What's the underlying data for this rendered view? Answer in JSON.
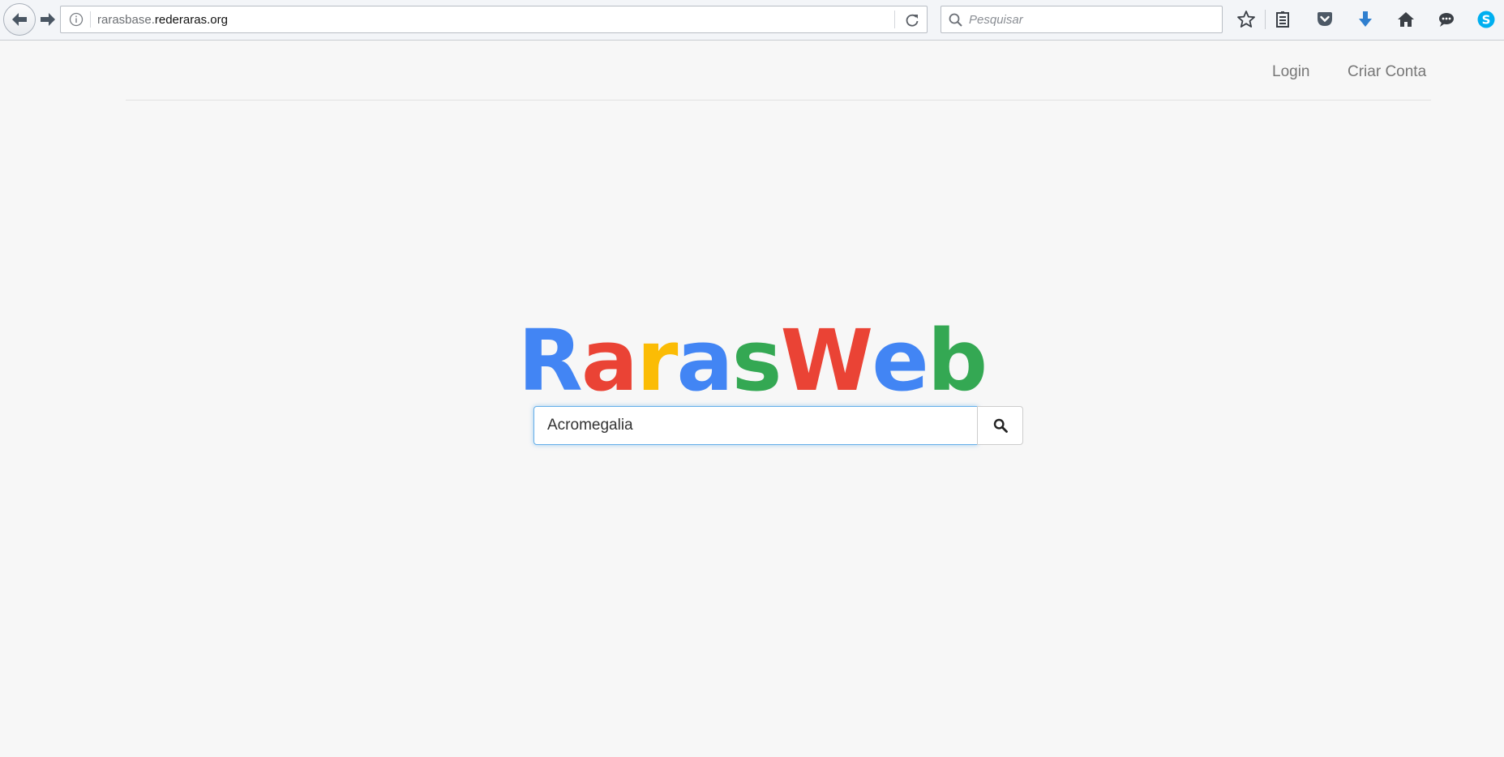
{
  "browser": {
    "url_prefix": "rarasbase.",
    "url_domain": "rederaras.org",
    "search_placeholder": "Pesquisar",
    "icons": [
      "back-icon",
      "forward-icon",
      "info-icon",
      "reload-icon",
      "search-icon",
      "bookmark-star-icon",
      "reading-list-icon",
      "pocket-icon",
      "download-icon",
      "home-icon",
      "chat-icon",
      "skype-icon"
    ]
  },
  "nav": {
    "login": "Login",
    "signup": "Criar Conta"
  },
  "logo": {
    "letters": [
      {
        "char": "R",
        "color": "#4285f4"
      },
      {
        "char": "a",
        "color": "#ea4335"
      },
      {
        "char": "r",
        "color": "#fbbc05"
      },
      {
        "char": "a",
        "color": "#4285f4"
      },
      {
        "char": "s",
        "color": "#34a853"
      },
      {
        "char": "W",
        "color": "#ea4335"
      },
      {
        "char": "e",
        "color": "#4285f4"
      },
      {
        "char": "b",
        "color": "#34a853"
      }
    ]
  },
  "search": {
    "value": "Acromegalia"
  }
}
